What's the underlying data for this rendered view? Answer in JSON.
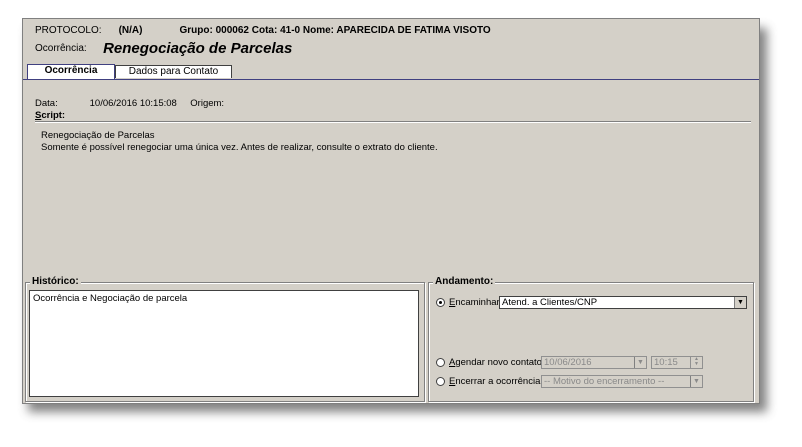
{
  "header": {
    "protocolo_label": "PROTOCOLO:",
    "protocolo_value": "(N/A)",
    "grupo_info": "Grupo: 000062 Cota: 41-0 Nome: APARECIDA DE FATIMA VISOTO",
    "ocorrencia_label": "Ocorrência:",
    "ocorrencia_value": "Renegociação de Parcelas"
  },
  "tabs": [
    {
      "label": "Ocorrência",
      "active": true
    },
    {
      "label": "Dados para Contato",
      "active": false
    }
  ],
  "ocorrencia_tab": {
    "data_label": "Data:",
    "data_value": "10/06/2016 10:15:08",
    "origem_label": "Origem:",
    "script_label_underlined": "S",
    "script_label_rest": "cript:",
    "script_lines": [
      "Renegociação de Parcelas",
      "Somente é possível renegociar uma única vez. Antes de realizar, consulte o extrato do cliente."
    ]
  },
  "historico": {
    "title": "Histórico:",
    "text": "Ocorrência e Negociação de parcela"
  },
  "andamento": {
    "title": "Andamento:",
    "encaminhar_u": "E",
    "encaminhar_rest": "ncaminhar:",
    "encaminhar_value": "Atend. a Clientes/CNP",
    "agendar_u": "A",
    "agendar_rest": "gendar novo contato",
    "agendar_date": "10/06/2016",
    "agendar_time": "10:15",
    "encerrar_u": "E",
    "encerrar_rest": "ncerrar a ocorrência",
    "motivo_placeholder": "-- Motivo do encerramento --",
    "selected": "encaminhar"
  }
}
